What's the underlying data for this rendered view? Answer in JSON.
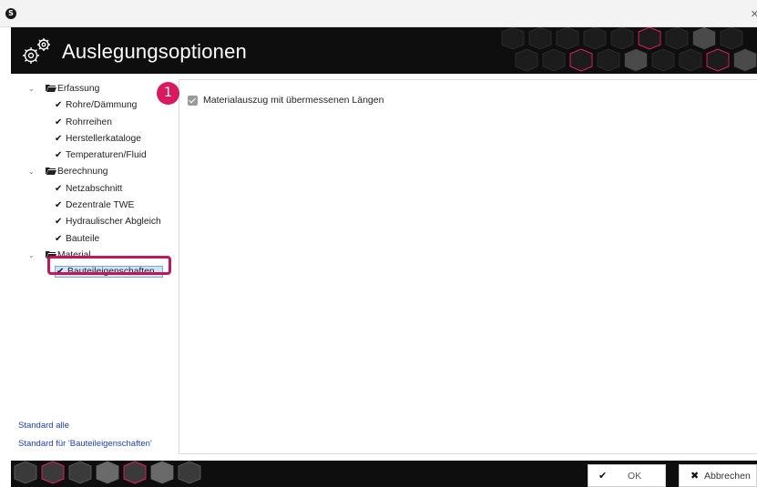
{
  "window": {
    "app_icon_glyph": "S",
    "close_glyph": "✕"
  },
  "header": {
    "title": "Auslegungsoptionen",
    "icon": "gears-icon",
    "accent": "#d81b60"
  },
  "tree": {
    "groups": [
      {
        "label": "Erfassung",
        "items": [
          "Rohre/Dämmung",
          "Rohrreihen",
          "Herstellerkataloge",
          "Temperaturen/Fluid"
        ]
      },
      {
        "label": "Berechnung",
        "items": [
          "Netzabschnitt",
          "Dezentrale TWE",
          "Hydraulischer Abgleich",
          "Bauteile"
        ]
      },
      {
        "label": "Material",
        "items": [
          "Bauteileigenschaften"
        ]
      }
    ],
    "selected": "Bauteileigenschaften",
    "check_glyph": "✔",
    "chevron_glyph": "⌄"
  },
  "links": {
    "standard_all": "Standard alle",
    "standard_for": "Standard für 'Bauteileigenschaften'"
  },
  "options": {
    "badge_number": "1",
    "material_oversize": {
      "label": "Materialauszug mit übermessenen Längen",
      "checked": true
    }
  },
  "buttons": {
    "ok": {
      "label": "OK",
      "icon_glyph": "✔"
    },
    "cancel": {
      "label": "Abbrechen",
      "icon_glyph": "✖"
    }
  }
}
